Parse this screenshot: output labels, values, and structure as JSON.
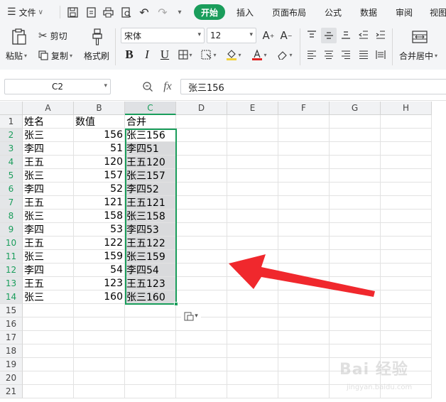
{
  "menubar": {
    "file_label": "文件",
    "tabs": [
      {
        "label": "开始",
        "active": true
      },
      {
        "label": "插入"
      },
      {
        "label": "页面布局"
      },
      {
        "label": "公式"
      },
      {
        "label": "数据"
      },
      {
        "label": "审阅"
      },
      {
        "label": "视图"
      }
    ],
    "accent_color": "#1a9d5b"
  },
  "ribbon": {
    "paste_label": "粘贴",
    "cut_label": "剪切",
    "copy_label": "复制",
    "format_painter_label": "格式刷",
    "font_name": "宋体",
    "font_size": "12",
    "bold_label": "B",
    "italic_label": "I",
    "underline_label": "U",
    "merge_center_label": "合并居中",
    "font_color": "#e02020",
    "fill_color": "#f2d23a"
  },
  "formula_bar": {
    "cell_ref": "C2",
    "fx_label": "fx",
    "content": "张三156"
  },
  "sheet": {
    "columns": [
      "A",
      "B",
      "C",
      "D",
      "E",
      "F",
      "G",
      "H"
    ],
    "active_column": "C",
    "row_numbers": [
      "1",
      "2",
      "3",
      "4",
      "5",
      "6",
      "7",
      "8",
      "9",
      "10",
      "11",
      "12",
      "13",
      "14",
      "15",
      "16",
      "17",
      "18",
      "19",
      "20",
      "21"
    ],
    "selection": {
      "column": "C",
      "from_row": 2,
      "to_row": 14
    },
    "rows": [
      {
        "a": "姓名",
        "b": "数值",
        "c": "合并"
      },
      {
        "a": "张三",
        "b": "156",
        "c": "张三156"
      },
      {
        "a": "李四",
        "b": "51",
        "c": "李四51"
      },
      {
        "a": "王五",
        "b": "120",
        "c": "王五120"
      },
      {
        "a": "张三",
        "b": "157",
        "c": "张三157"
      },
      {
        "a": "李四",
        "b": "52",
        "c": "李四52"
      },
      {
        "a": "王五",
        "b": "121",
        "c": "王五121"
      },
      {
        "a": "张三",
        "b": "158",
        "c": "张三158"
      },
      {
        "a": "李四",
        "b": "53",
        "c": "李四53"
      },
      {
        "a": "王五",
        "b": "122",
        "c": "王五122"
      },
      {
        "a": "张三",
        "b": "159",
        "c": "张三159"
      },
      {
        "a": "李四",
        "b": "54",
        "c": "李四54"
      },
      {
        "a": "王五",
        "b": "123",
        "c": "王五123"
      },
      {
        "a": "张三",
        "b": "160",
        "c": "张三160"
      }
    ]
  },
  "annotation": {
    "arrow_color": "#f0282d"
  },
  "watermark": {
    "brand": "Bai 经验",
    "url": "jingyan.baidu.com"
  }
}
